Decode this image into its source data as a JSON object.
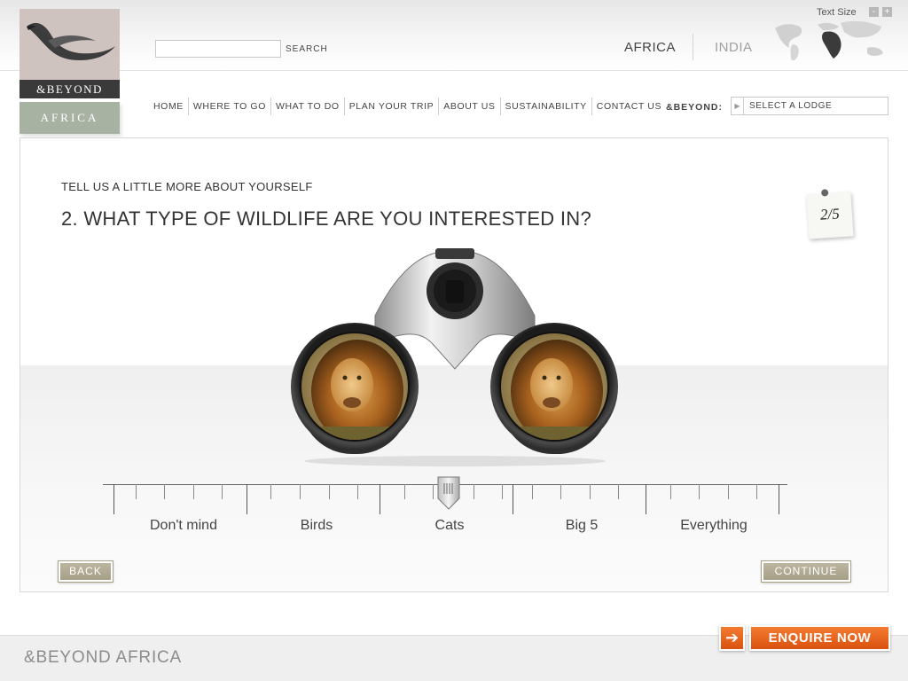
{
  "header": {
    "logo": {
      "brand": "&BEYOND",
      "region": "AFRICA"
    },
    "search": {
      "value": "",
      "button_label": "SEARCH"
    },
    "regions": [
      "AFRICA",
      "INDIA"
    ],
    "text_size": {
      "label": "Text Size",
      "minus": "-",
      "plus": "+"
    }
  },
  "nav": {
    "items": [
      "HOME",
      "WHERE TO GO",
      "WHAT TO DO",
      "PLAN YOUR TRIP",
      "ABOUT US",
      "SUSTAINABILITY",
      "CONTACT US"
    ],
    "brand_label": "&BEYOND:",
    "lodge_select": {
      "selected": "SELECT A LODGE",
      "arrow_icon": "triangle-right-icon"
    }
  },
  "main": {
    "kicker": "TELL US A LITTLE MORE ABOUT YOURSELF",
    "question": "2. WHAT TYPE OF WILDLIFE ARE YOU INTERESTED IN?",
    "step": {
      "current": "2",
      "total": "5",
      "label": "2/5"
    },
    "slider": {
      "options": [
        "Don't mind",
        "Birds",
        "Cats",
        "Big 5",
        "Everything"
      ],
      "selected": "Cats",
      "selected_index": 2
    },
    "back_label": "BACK",
    "continue_label": "CONTINUE"
  },
  "footer": {
    "brand": "&BEYOND AFRICA",
    "enquire_label": "ENQUIRE NOW",
    "enquire_icon": "arrow-right-icon"
  },
  "colors": {
    "accent_orange": "#e8621c",
    "button_khaki": "#aba48d",
    "logo_mauve": "#cfc3bf",
    "logo_sage": "#a8b2a3"
  }
}
